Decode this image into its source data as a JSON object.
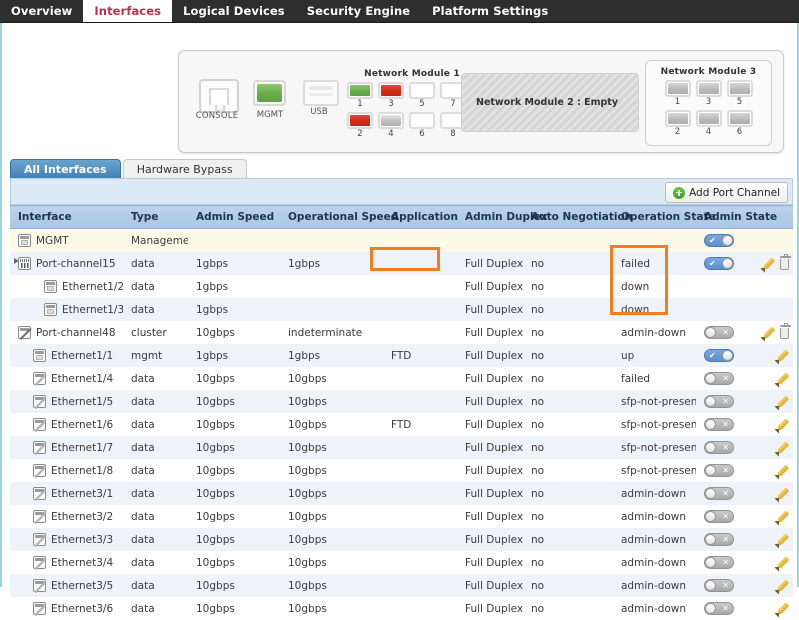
{
  "topnav": {
    "tabs": [
      {
        "label": "Overview",
        "active": false
      },
      {
        "label": "Interfaces",
        "active": true
      },
      {
        "label": "Logical Devices",
        "active": false
      },
      {
        "label": "Security Engine",
        "active": false
      },
      {
        "label": "Platform Settings",
        "active": false
      }
    ]
  },
  "chassis": {
    "console_label": "CONSOLE",
    "mgmt_label": "MGMT",
    "usb_label": "USB",
    "module1": {
      "title": "Network Module 1",
      "top_row": [
        {
          "num": "1",
          "state": "green"
        },
        {
          "num": "3",
          "state": "red"
        },
        {
          "num": "5",
          "state": "empty"
        },
        {
          "num": "7",
          "state": "empty"
        }
      ],
      "bottom_row": [
        {
          "num": "2",
          "state": "red"
        },
        {
          "num": "4",
          "state": "gray"
        },
        {
          "num": "6",
          "state": "empty"
        },
        {
          "num": "8",
          "state": "empty"
        }
      ]
    },
    "module2": {
      "title": "Network Module 2 : Empty"
    },
    "module3": {
      "title": "Network Module 3",
      "top_row": [
        {
          "num": "1",
          "state": "dgray"
        },
        {
          "num": "3",
          "state": "dgray"
        },
        {
          "num": "5",
          "state": "dgray"
        }
      ],
      "bottom_row": [
        {
          "num": "2",
          "state": "dgray"
        },
        {
          "num": "4",
          "state": "dgray"
        },
        {
          "num": "6",
          "state": "dgray"
        }
      ]
    }
  },
  "subtabs": [
    {
      "label": "All Interfaces",
      "active": true
    },
    {
      "label": "Hardware Bypass",
      "active": false
    }
  ],
  "toolbar": {
    "add_port_channel_label": "Add Port Channel"
  },
  "table": {
    "columns": [
      "Interface",
      "Type",
      "Admin Speed",
      "Operational Speed",
      "Application",
      "Admin Duplex",
      "Auto Negotiation",
      "Operation State",
      "Admin State"
    ],
    "rows": [
      {
        "interface": "MGMT",
        "icon": "mgmt-icon",
        "indent": 0,
        "expander": false,
        "type": "Management",
        "admin_speed": "",
        "operational_speed": "",
        "application": "",
        "admin_duplex": "",
        "auto_negotiation": "",
        "operation_state": "",
        "admin_state": "on",
        "actions": [],
        "stripe": "mgmt"
      },
      {
        "interface": "Port-channel15",
        "icon": "port-channel-icon",
        "indent": 0,
        "expander": true,
        "type": "data",
        "admin_speed": "1gbps",
        "operational_speed": "1gbps",
        "application": "",
        "admin_duplex": "Full Duplex",
        "auto_negotiation": "no",
        "operation_state": "failed",
        "admin_state": "on",
        "actions": [
          "edit",
          "delete"
        ],
        "stripe": "even"
      },
      {
        "interface": "Ethernet1/2",
        "icon": "ethernet-icon",
        "indent": 2,
        "expander": false,
        "type": "data",
        "admin_speed": "1gbps",
        "operational_speed": "",
        "application": "",
        "admin_duplex": "Full Duplex",
        "auto_negotiation": "no",
        "operation_state": "down",
        "admin_state": "none",
        "actions": [],
        "stripe": "odd"
      },
      {
        "interface": "Ethernet1/3",
        "icon": "ethernet-icon",
        "indent": 2,
        "expander": false,
        "type": "data",
        "admin_speed": "1gbps",
        "operational_speed": "",
        "application": "",
        "admin_duplex": "Full Duplex",
        "auto_negotiation": "no",
        "operation_state": "down",
        "admin_state": "none",
        "actions": [],
        "stripe": "even"
      },
      {
        "interface": "Port-channel48",
        "icon": "port-channel-disabled-icon",
        "indent": 0,
        "expander": false,
        "type": "cluster",
        "admin_speed": "10gbps",
        "operational_speed": "indeterminate",
        "application": "",
        "admin_duplex": "Full Duplex",
        "auto_negotiation": "no",
        "operation_state": "admin-down",
        "admin_state": "off",
        "actions": [
          "edit",
          "delete"
        ],
        "stripe": "odd"
      },
      {
        "interface": "Ethernet1/1",
        "icon": "ethernet-icon",
        "indent": 1,
        "expander": false,
        "type": "mgmt",
        "admin_speed": "1gbps",
        "operational_speed": "1gbps",
        "application": "FTD",
        "admin_duplex": "Full Duplex",
        "auto_negotiation": "no",
        "operation_state": "up",
        "admin_state": "on",
        "actions": [
          "edit"
        ],
        "stripe": "even"
      },
      {
        "interface": "Ethernet1/4",
        "icon": "ethernet-disabled-icon",
        "indent": 1,
        "expander": false,
        "type": "data",
        "admin_speed": "10gbps",
        "operational_speed": "10gbps",
        "application": "",
        "admin_duplex": "Full Duplex",
        "auto_negotiation": "no",
        "operation_state": "failed",
        "admin_state": "off",
        "actions": [
          "edit"
        ],
        "stripe": "odd"
      },
      {
        "interface": "Ethernet1/5",
        "icon": "ethernet-disabled-icon",
        "indent": 1,
        "expander": false,
        "type": "data",
        "admin_speed": "10gbps",
        "operational_speed": "10gbps",
        "application": "",
        "admin_duplex": "Full Duplex",
        "auto_negotiation": "no",
        "operation_state": "sfp-not-present",
        "admin_state": "off",
        "actions": [
          "edit"
        ],
        "stripe": "even"
      },
      {
        "interface": "Ethernet1/6",
        "icon": "ethernet-disabled-icon",
        "indent": 1,
        "expander": false,
        "type": "data",
        "admin_speed": "10gbps",
        "operational_speed": "10gbps",
        "application": "FTD",
        "admin_duplex": "Full Duplex",
        "auto_negotiation": "no",
        "operation_state": "sfp-not-present",
        "admin_state": "off",
        "actions": [
          "edit"
        ],
        "stripe": "odd"
      },
      {
        "interface": "Ethernet1/7",
        "icon": "ethernet-disabled-icon",
        "indent": 1,
        "expander": false,
        "type": "data",
        "admin_speed": "10gbps",
        "operational_speed": "10gbps",
        "application": "",
        "admin_duplex": "Full Duplex",
        "auto_negotiation": "no",
        "operation_state": "sfp-not-present",
        "admin_state": "off",
        "actions": [
          "edit"
        ],
        "stripe": "even"
      },
      {
        "interface": "Ethernet1/8",
        "icon": "ethernet-disabled-icon",
        "indent": 1,
        "expander": false,
        "type": "data",
        "admin_speed": "10gbps",
        "operational_speed": "10gbps",
        "application": "",
        "admin_duplex": "Full Duplex",
        "auto_negotiation": "no",
        "operation_state": "sfp-not-present",
        "admin_state": "off",
        "actions": [
          "edit"
        ],
        "stripe": "odd"
      },
      {
        "interface": "Ethernet3/1",
        "icon": "ethernet-disabled-icon",
        "indent": 1,
        "expander": false,
        "type": "data",
        "admin_speed": "10gbps",
        "operational_speed": "10gbps",
        "application": "",
        "admin_duplex": "Full Duplex",
        "auto_negotiation": "no",
        "operation_state": "admin-down",
        "admin_state": "off",
        "actions": [
          "edit"
        ],
        "stripe": "even"
      },
      {
        "interface": "Ethernet3/2",
        "icon": "ethernet-disabled-icon",
        "indent": 1,
        "expander": false,
        "type": "data",
        "admin_speed": "10gbps",
        "operational_speed": "10gbps",
        "application": "",
        "admin_duplex": "Full Duplex",
        "auto_negotiation": "no",
        "operation_state": "admin-down",
        "admin_state": "off",
        "actions": [
          "edit"
        ],
        "stripe": "odd"
      },
      {
        "interface": "Ethernet3/3",
        "icon": "ethernet-disabled-icon",
        "indent": 1,
        "expander": false,
        "type": "data",
        "admin_speed": "10gbps",
        "operational_speed": "10gbps",
        "application": "",
        "admin_duplex": "Full Duplex",
        "auto_negotiation": "no",
        "operation_state": "admin-down",
        "admin_state": "off",
        "actions": [
          "edit"
        ],
        "stripe": "even"
      },
      {
        "interface": "Ethernet3/4",
        "icon": "ethernet-disabled-icon",
        "indent": 1,
        "expander": false,
        "type": "data",
        "admin_speed": "10gbps",
        "operational_speed": "10gbps",
        "application": "",
        "admin_duplex": "Full Duplex",
        "auto_negotiation": "no",
        "operation_state": "admin-down",
        "admin_state": "off",
        "actions": [
          "edit"
        ],
        "stripe": "odd"
      },
      {
        "interface": "Ethernet3/5",
        "icon": "ethernet-disabled-icon",
        "indent": 1,
        "expander": false,
        "type": "data",
        "admin_speed": "10gbps",
        "operational_speed": "10gbps",
        "application": "",
        "admin_duplex": "Full Duplex",
        "auto_negotiation": "no",
        "operation_state": "admin-down",
        "admin_state": "off",
        "actions": [
          "edit"
        ],
        "stripe": "even"
      },
      {
        "interface": "Ethernet3/6",
        "icon": "ethernet-disabled-icon",
        "indent": 1,
        "expander": false,
        "type": "data",
        "admin_speed": "10gbps",
        "operational_speed": "10gbps",
        "application": "",
        "admin_duplex": "Full Duplex",
        "auto_negotiation": "no",
        "operation_state": "admin-down",
        "admin_state": "off",
        "actions": [
          "edit"
        ],
        "stripe": "odd"
      }
    ]
  },
  "highlights": [
    {
      "name": "application-cell-highlight",
      "color": "#f07d1e"
    },
    {
      "name": "operation-state-highlight",
      "color": "#f07d1e"
    }
  ]
}
